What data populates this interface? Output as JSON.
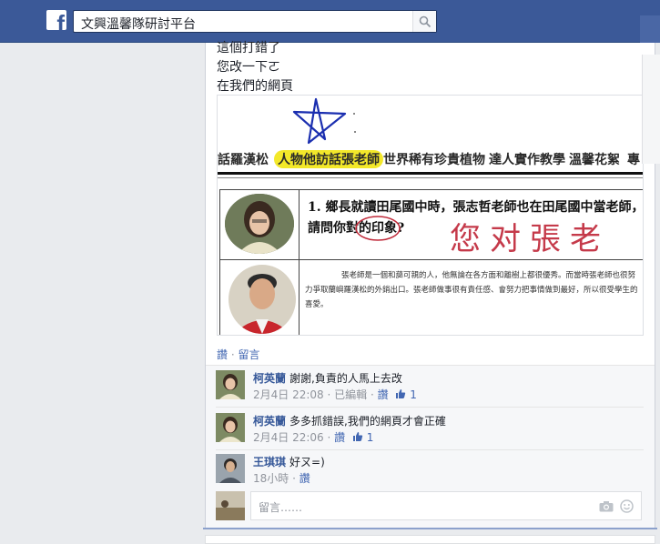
{
  "topbar": {
    "logo": "f",
    "search_value": "文興溫馨隊研討平台",
    "search_icon": "search-icon"
  },
  "post": {
    "lines": [
      "這個打錯了",
      "您改一下ㄛ",
      "在我們的網頁"
    ]
  },
  "shared_image": {
    "nav_items": [
      "話羅漢松",
      "人物他訪話張老師",
      "世界稀有珍貴植物",
      "達人實作教學",
      "溫馨花絮",
      "專"
    ],
    "question": "1. 鄉長就讀田尾國中時，張志哲老師也在田尾國中當老師，請問你對的印象?",
    "handwriting": "您对張老",
    "answer": "張老師是一個和藹可親的人，他無論在各方面和離樹上都很優秀。而當時張老師也很努力爭取蘭嶼羅漢松的外銷出口。張老師做事很有責任感、會努力把事情做到最好，所以很受學生的喜愛。"
  },
  "actions": {
    "like": "讚",
    "comment": "留言"
  },
  "comments": [
    {
      "name": "柯英蘭",
      "text": "謝謝,負責的人馬上去改",
      "time": "2月4日 22:08",
      "edited": "已編輯",
      "like": "讚",
      "like_count": "1"
    },
    {
      "name": "柯英蘭",
      "text": "多多抓錯誤,我們的網頁才會正確",
      "time": "2月4日 22:06",
      "like": "讚",
      "like_count": "1"
    },
    {
      "name": "王琪琪",
      "text": "好ㄡ=)",
      "time": "18小時",
      "like": "讚"
    }
  ],
  "reply": {
    "placeholder": "留言……"
  },
  "colors": {
    "brand": "#3b5998",
    "link": "#4267b2",
    "highlight": "#f3e82a"
  }
}
